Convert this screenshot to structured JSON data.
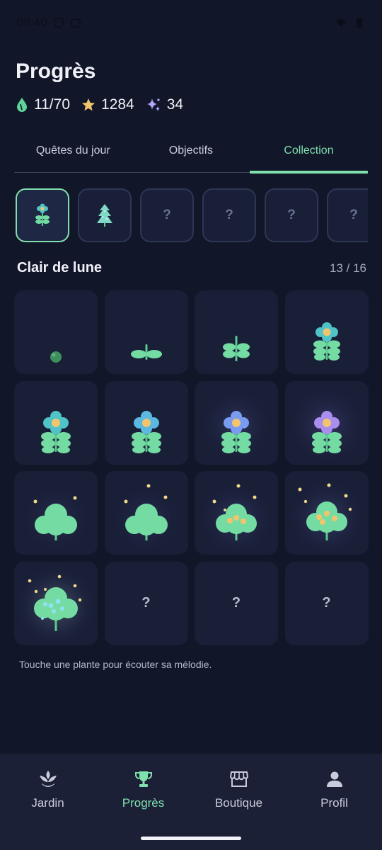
{
  "status_bar": {
    "time": "09:40",
    "left_icons": [
      "shield-icon",
      "record-icon"
    ],
    "right_icons": [
      "wifi-icon",
      "battery-icon"
    ]
  },
  "header": {
    "title": "Progrès",
    "stats": [
      {
        "icon": "water-drop-icon",
        "value": "11/70",
        "color": "#5fd39a"
      },
      {
        "icon": "star-icon",
        "value": "1284",
        "color": "#f2c46d"
      },
      {
        "icon": "sparkle-icon",
        "value": "34",
        "color": "#b7a6ff"
      }
    ]
  },
  "tabs": [
    {
      "label": "Quêtes du jour",
      "active": false
    },
    {
      "label": "Objectifs",
      "active": false
    },
    {
      "label": "Collection",
      "active": true
    }
  ],
  "collection_sets": [
    {
      "unlocked": true,
      "selected": true,
      "icon": "flower-plant-icon"
    },
    {
      "unlocked": true,
      "selected": false,
      "icon": "pine-plant-icon"
    },
    {
      "unlocked": false,
      "label": "?"
    },
    {
      "unlocked": false,
      "label": "?"
    },
    {
      "unlocked": false,
      "label": "?"
    },
    {
      "unlocked": false,
      "label": "?"
    }
  ],
  "current_set": {
    "title": "Clair de lune",
    "count": "13 / 16"
  },
  "plants": [
    {
      "stage": "seed",
      "icon": "seed-icon"
    },
    {
      "stage": "sprout",
      "icon": "sprout-icon"
    },
    {
      "stage": "seedling",
      "icon": "seedling-icon"
    },
    {
      "stage": "bud",
      "icon": "flower-icon"
    },
    {
      "stage": "flower-teal",
      "icon": "flower-icon"
    },
    {
      "stage": "flower-blue",
      "icon": "flower-icon"
    },
    {
      "stage": "flower-periwinkle",
      "icon": "flower-icon"
    },
    {
      "stage": "flower-violet",
      "icon": "flower-icon"
    },
    {
      "stage": "bush",
      "icon": "bush-icon"
    },
    {
      "stage": "bush-firefly",
      "icon": "bush-icon"
    },
    {
      "stage": "bush-fruit",
      "icon": "bush-icon"
    },
    {
      "stage": "bush-blooming",
      "icon": "bush-icon"
    },
    {
      "stage": "bush-glowing",
      "icon": "bush-icon"
    },
    {
      "stage": "locked",
      "label": "?"
    },
    {
      "stage": "locked",
      "label": "?"
    },
    {
      "stage": "locked",
      "label": "?"
    }
  ],
  "hint": "Touche une plante pour écouter sa mélodie.",
  "nav": [
    {
      "label": "Jardin",
      "icon": "garden-icon",
      "active": false
    },
    {
      "label": "Progrès",
      "icon": "trophy-icon",
      "active": true
    },
    {
      "label": "Boutique",
      "icon": "shop-icon",
      "active": false
    },
    {
      "label": "Profil",
      "icon": "profile-icon",
      "active": false
    }
  ],
  "colors": {
    "background": "#121629",
    "card": "#1a1f38",
    "accent": "#7fe0ad",
    "leaf": "#74dca3"
  }
}
